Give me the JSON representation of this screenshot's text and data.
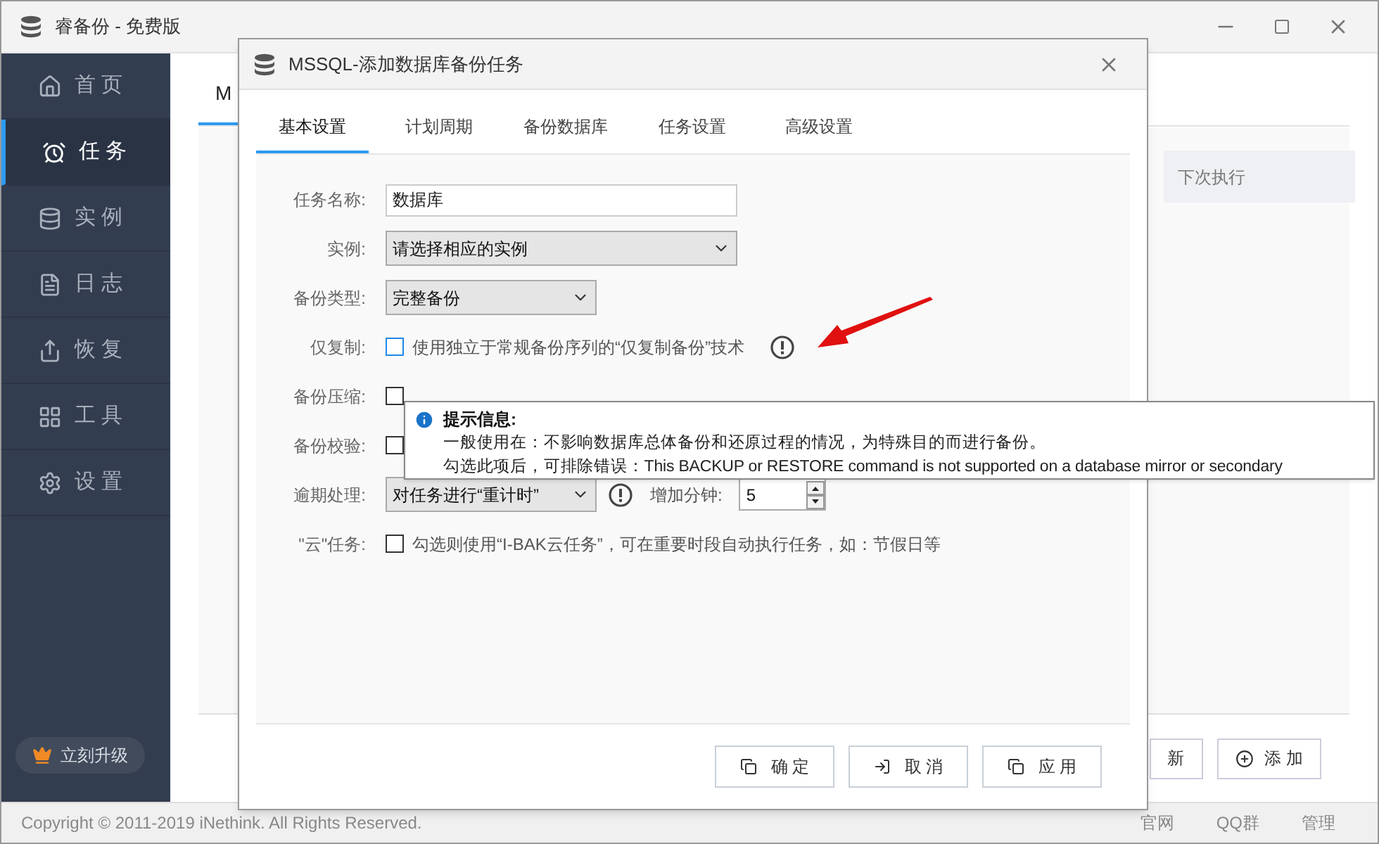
{
  "app": {
    "title": "睿备份 - 免费版"
  },
  "sidebar": {
    "items": [
      {
        "label": "首 页",
        "selected": false
      },
      {
        "label": "任 务",
        "selected": true
      },
      {
        "label": "实 例",
        "selected": false
      },
      {
        "label": "日 志",
        "selected": false
      },
      {
        "label": "恢 复",
        "selected": false
      },
      {
        "label": "工 具",
        "selected": false
      },
      {
        "label": "设 置",
        "selected": false
      }
    ],
    "upgrade": "立刻升级"
  },
  "main": {
    "tab": "M",
    "column": "下次执行",
    "buttons": [
      "新",
      "添 加"
    ]
  },
  "footer": {
    "copyright": "Copyright © 2011-2019 iNethink. All Rights Reserved.",
    "links": [
      "官网",
      "QQ群",
      "管理"
    ]
  },
  "dialog": {
    "title": "MSSQL-添加数据库备份任务",
    "tabs": [
      {
        "label": "基本设置",
        "selected": true
      },
      {
        "label": "计划周期",
        "selected": false
      },
      {
        "label": "备份数据库",
        "selected": false
      },
      {
        "label": "任务设置",
        "selected": false
      },
      {
        "label": "高级设置",
        "selected": false
      }
    ],
    "fields": [
      {
        "kind": "text",
        "label": "任务名称:",
        "value": "数据库"
      },
      {
        "kind": "select",
        "label": "实例:",
        "value": "请选择相应的实例"
      },
      {
        "kind": "short-select",
        "label": "备份类型:",
        "value": "完整备份"
      },
      {
        "kind": "checkbox",
        "label": "仅复制:",
        "checked": false,
        "text": "使用独立于常规备份序列的“仅复制备份”技术",
        "info": true
      },
      {
        "kind": "checkbox",
        "label": "备份压缩:",
        "checked": false
      },
      {
        "kind": "checkbox",
        "label": "备份校验:",
        "checked": false
      },
      {
        "kind": "overdue",
        "label": "逾期处理:",
        "value": "对任务进行“重计时”",
        "extra_label": "增加分钟:",
        "minutes": "5"
      },
      {
        "kind": "checkbox",
        "label": "\"云\"任务:",
        "checked": false,
        "text": "勾选则使用“I-BAK云任务”，可在重要时段自动执行任务，如：节假日等",
        "info": false
      }
    ],
    "buttons": [
      "确 定",
      "取 消",
      "应 用"
    ]
  },
  "tooltip": {
    "title": "提示信息:",
    "lines": [
      "一般使用在：不影响数据库总体备份和还原过程的情况，为特殊目的而进行备份。",
      "勾选此项后，可排除错误：This BACKUP or RESTORE command is not supported on a database mirror or secondary"
    ]
  }
}
